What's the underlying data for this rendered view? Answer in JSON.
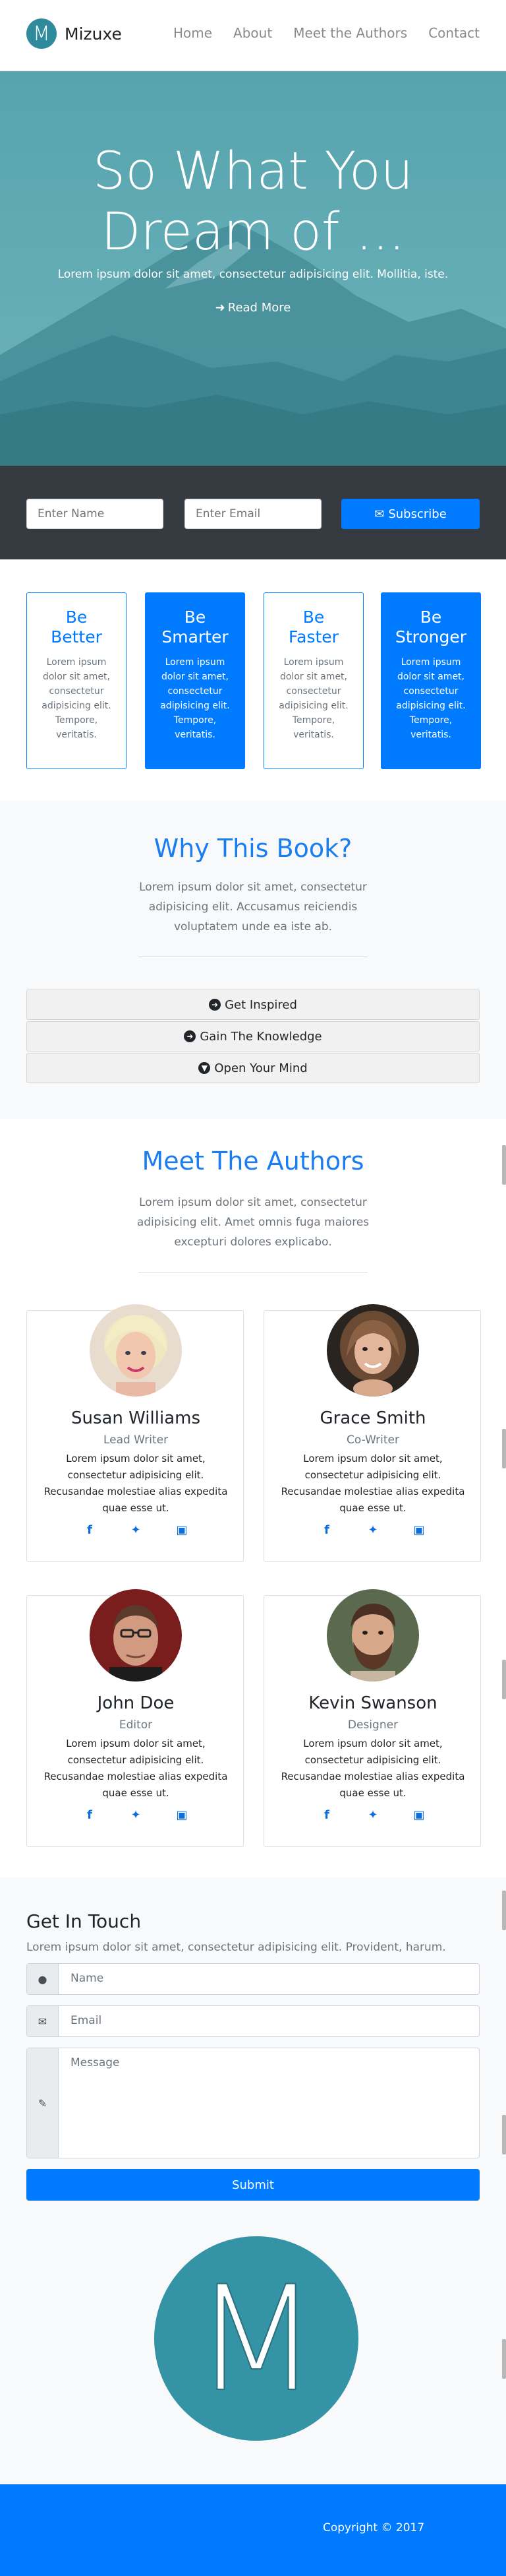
{
  "brand": {
    "logo_letter": "M",
    "name": "Mizuxe"
  },
  "nav": {
    "items": [
      {
        "label": "Home"
      },
      {
        "label": "About"
      },
      {
        "label": "Meet the Authors"
      },
      {
        "label": "Contact"
      }
    ]
  },
  "hero": {
    "title_line1": "So What You",
    "title_line2": "Dream of ...",
    "subtitle": "Lorem ipsum dolor sit amet, consectetur adipisicing elit. Mollitia, iste.",
    "read_more": "Read More"
  },
  "newsletter": {
    "name_placeholder": "Enter Name",
    "email_placeholder": "Enter Email",
    "subscribe_label": "Subscribe"
  },
  "boxes": [
    {
      "title_line1": "Be",
      "title_line2": "Better",
      "text": "Lorem ipsum dolor sit amet, consectetur adipisicing elit. Tempore, veritatis.",
      "style": "outline"
    },
    {
      "title_line1": "Be",
      "title_line2": "Smarter",
      "text": "Lorem ipsum dolor sit amet, consectetur adipisicing elit. Tempore, veritatis.",
      "style": "primary"
    },
    {
      "title_line1": "Be",
      "title_line2": "Faster",
      "text": "Lorem ipsum dolor sit amet, consectetur adipisicing elit. Tempore, veritatis.",
      "style": "outline"
    },
    {
      "title_line1": "Be",
      "title_line2": "Stronger",
      "text": "Lorem ipsum dolor sit amet, consectetur adipisicing elit. Tempore, veritatis.",
      "style": "primary"
    }
  ],
  "why": {
    "title": "Why This Book?",
    "lead": "Lorem ipsum dolor sit amet, consectetur adipisicing elit. Accusamus reiciendis voluptatem unde ea iste ab.",
    "accordion": [
      {
        "label": "Get Inspired"
      },
      {
        "label": "Gain The Knowledge"
      },
      {
        "label": "Open Your Mind"
      }
    ]
  },
  "authors": {
    "title": "Meet The Authors",
    "lead": "Lorem ipsum dolor sit amet, consectetur adipisicing elit. Amet omnis fuga maiores excepturi dolores explicabo.",
    "list": [
      {
        "name": "Susan Williams",
        "role": "Lead Writer",
        "bio": "Lorem ipsum dolor sit amet, consectetur adipisicing elit. Recusandae molestiae alias expedita quae esse ut."
      },
      {
        "name": "Grace Smith",
        "role": "Co-Writer",
        "bio": "Lorem ipsum dolor sit amet, consectetur adipisicing elit. Recusandae molestiae alias expedita quae esse ut."
      },
      {
        "name": "John Doe",
        "role": "Editor",
        "bio": "Lorem ipsum dolor sit amet, consectetur adipisicing elit. Recusandae molestiae alias expedita quae esse ut."
      },
      {
        "name": "Kevin Swanson",
        "role": "Designer",
        "bio": "Lorem ipsum dolor sit amet, consectetur adipisicing elit. Recusandae molestiae alias expedita quae esse ut."
      }
    ],
    "social_icons": [
      "facebook-icon",
      "twitter-icon",
      "instagram-icon"
    ]
  },
  "contact": {
    "title": "Get In Touch",
    "lead": "Lorem ipsum dolor sit amet, consectetur adipisicing elit. Provident, harum.",
    "name_placeholder": "Name",
    "email_placeholder": "Email",
    "message_placeholder": "Message",
    "submit_label": "Submit",
    "logo_letter": "M"
  },
  "footer": {
    "copyright": "Copyright © 2017"
  },
  "colors": {
    "primary": "#007bff",
    "teal": "#3493a4",
    "dark": "#343a40",
    "light": "#f8f9fa"
  }
}
